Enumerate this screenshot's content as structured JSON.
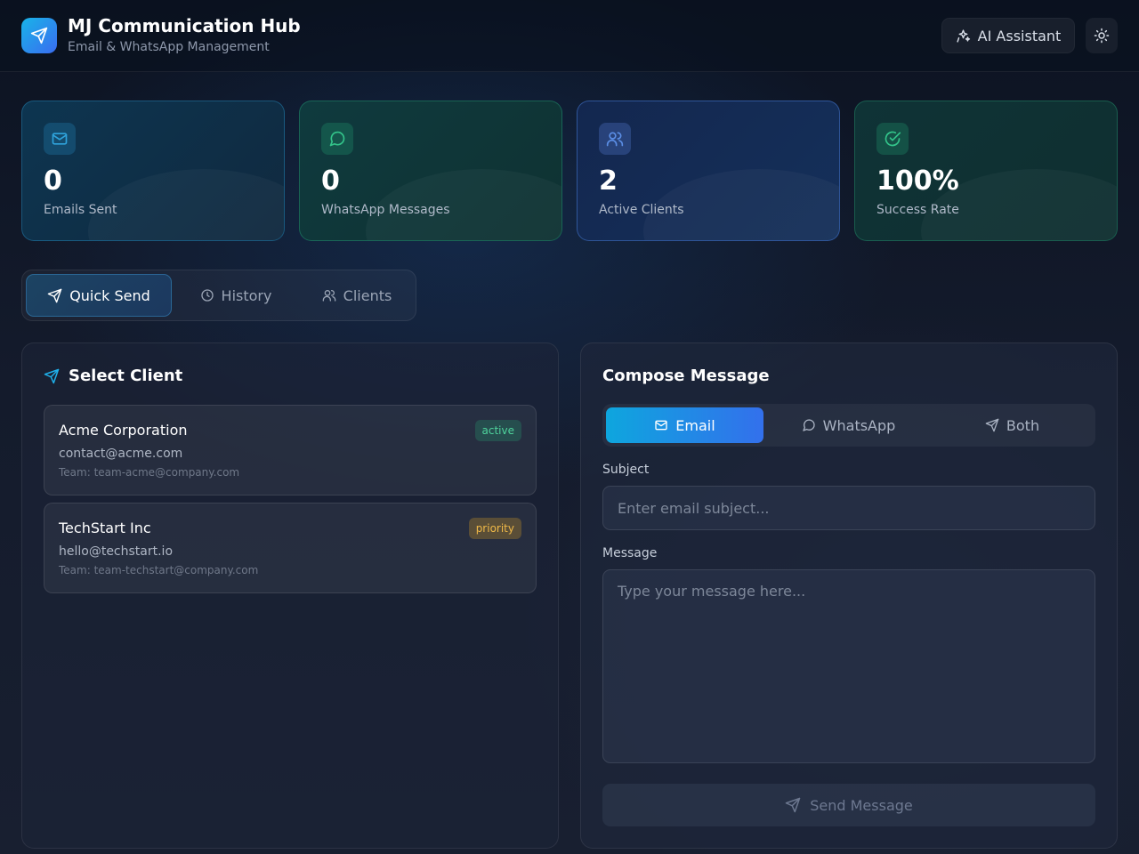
{
  "header": {
    "title": "MJ Communication Hub",
    "subtitle": "Email & WhatsApp Management",
    "ai_button_label": "AI Assistant",
    "logo_icon": "send-icon",
    "theme_icon": "sun-icon"
  },
  "stats": [
    {
      "value": "0",
      "label": "Emails Sent",
      "icon": "mail-icon",
      "color": "#2fa3dc"
    },
    {
      "value": "0",
      "label": "WhatsApp Messages",
      "icon": "message-circle-icon",
      "color": "#33c48a"
    },
    {
      "value": "2",
      "label": "Active Clients",
      "icon": "users-icon",
      "color": "#5b8ee6"
    },
    {
      "value": "100%",
      "label": "Success Rate",
      "icon": "check-circle-icon",
      "color": "#33c48a"
    }
  ],
  "tabs": [
    {
      "label": "Quick Send",
      "icon": "send-icon",
      "active": true
    },
    {
      "label": "History",
      "icon": "clock-icon",
      "active": false
    },
    {
      "label": "Clients",
      "icon": "users-icon",
      "active": false
    }
  ],
  "select_client": {
    "title": "Select Client",
    "clients": [
      {
        "name": "Acme Corporation",
        "email": "contact@acme.com",
        "team": "Team: team-acme@company.com",
        "status": "active"
      },
      {
        "name": "TechStart Inc",
        "email": "hello@techstart.io",
        "team": "Team: team-techstart@company.com",
        "status": "priority"
      }
    ]
  },
  "compose": {
    "title": "Compose Message",
    "modes": [
      {
        "label": "Email",
        "icon": "mail-icon",
        "active": true
      },
      {
        "label": "WhatsApp",
        "icon": "message-circle-icon",
        "active": false
      },
      {
        "label": "Both",
        "icon": "send-icon",
        "active": false
      }
    ],
    "subject_label": "Subject",
    "subject_placeholder": "Enter email subject...",
    "subject_value": "",
    "message_label": "Message",
    "message_placeholder": "Type your message here...",
    "message_value": "",
    "send_label": "Send Message"
  },
  "colors": {
    "accent": "#0ea6de",
    "accent_secondary": "#3370ec",
    "badge_active": "#4fd39c",
    "badge_priority": "#f0b948"
  }
}
